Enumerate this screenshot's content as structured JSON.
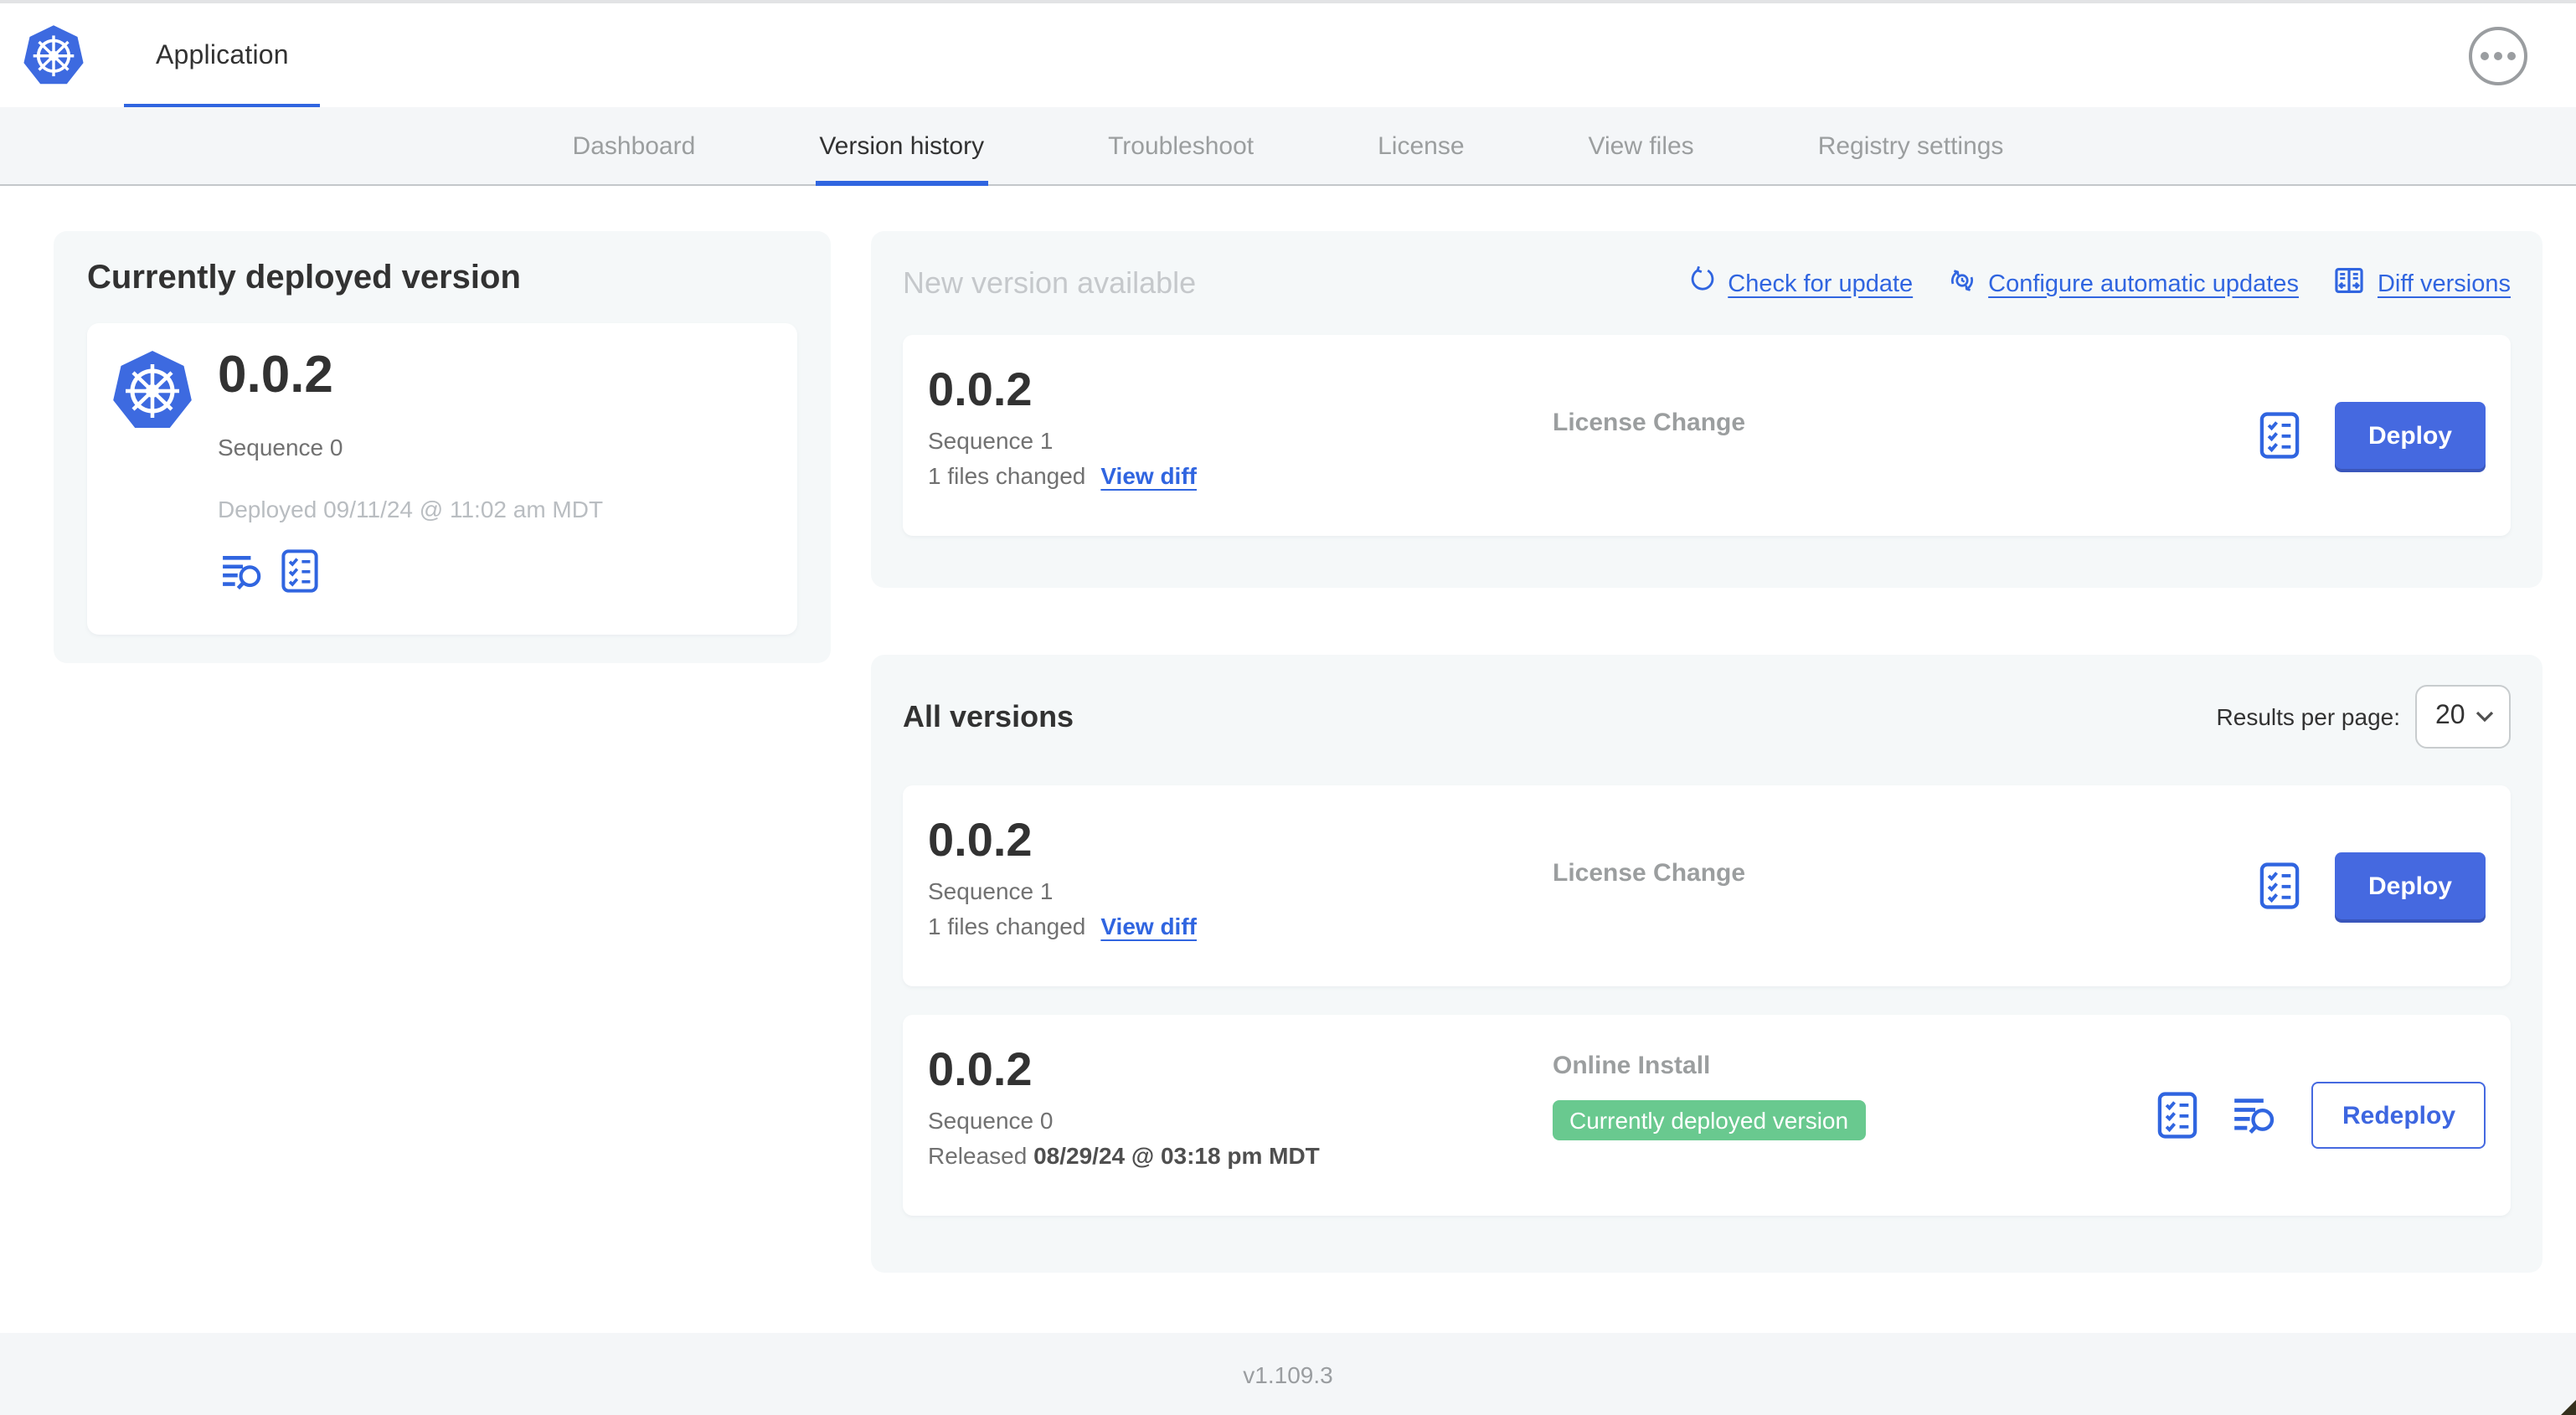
{
  "header": {
    "app_tab": "Application"
  },
  "nav": {
    "tabs": [
      {
        "label": "Dashboard"
      },
      {
        "label": "Version history"
      },
      {
        "label": "Troubleshoot"
      },
      {
        "label": "License"
      },
      {
        "label": "View files"
      },
      {
        "label": "Registry settings"
      }
    ]
  },
  "current_version": {
    "title": "Currently deployed version",
    "version": "0.0.2",
    "sequence": "Sequence 0",
    "deployed": "Deployed 09/11/24 @ 11:02 am MDT"
  },
  "new_version": {
    "title": "New version available",
    "links": {
      "check": "Check for update",
      "configure": "Configure automatic updates",
      "diff": "Diff versions"
    },
    "row": {
      "version": "0.0.2",
      "sequence": "Sequence 1",
      "files_changed": "1 files changed",
      "view_diff": "View diff",
      "source": "License Change",
      "deploy_label": "Deploy"
    }
  },
  "all_versions": {
    "title": "All versions",
    "results_per_page_label": "Results per page:",
    "results_per_page_value": "20",
    "rows": [
      {
        "version": "0.0.2",
        "sequence": "Sequence 1",
        "files_changed": "1 files changed",
        "view_diff": "View diff",
        "source": "License Change",
        "deploy_label": "Deploy"
      },
      {
        "version": "0.0.2",
        "sequence": "Sequence 0",
        "released_label": "Released ",
        "released_date": "08/29/24 @ 03:18 pm MDT",
        "source": "Online Install",
        "badge": "Currently deployed version",
        "redeploy_label": "Redeploy"
      }
    ]
  },
  "footer": {
    "version": "v1.109.3"
  },
  "colors": {
    "accent": "#3065e0",
    "button": "#4569e0",
    "badge_green": "#69c98f"
  },
  "icons": {
    "logo": "kubernetes-wheel",
    "more": "ellipsis-circle",
    "check_update": "refresh-arrow",
    "configure": "clock-refresh",
    "diff": "split-diff",
    "preflight": "checklist",
    "logs": "lines-magnifier",
    "select": "chevron-down"
  }
}
